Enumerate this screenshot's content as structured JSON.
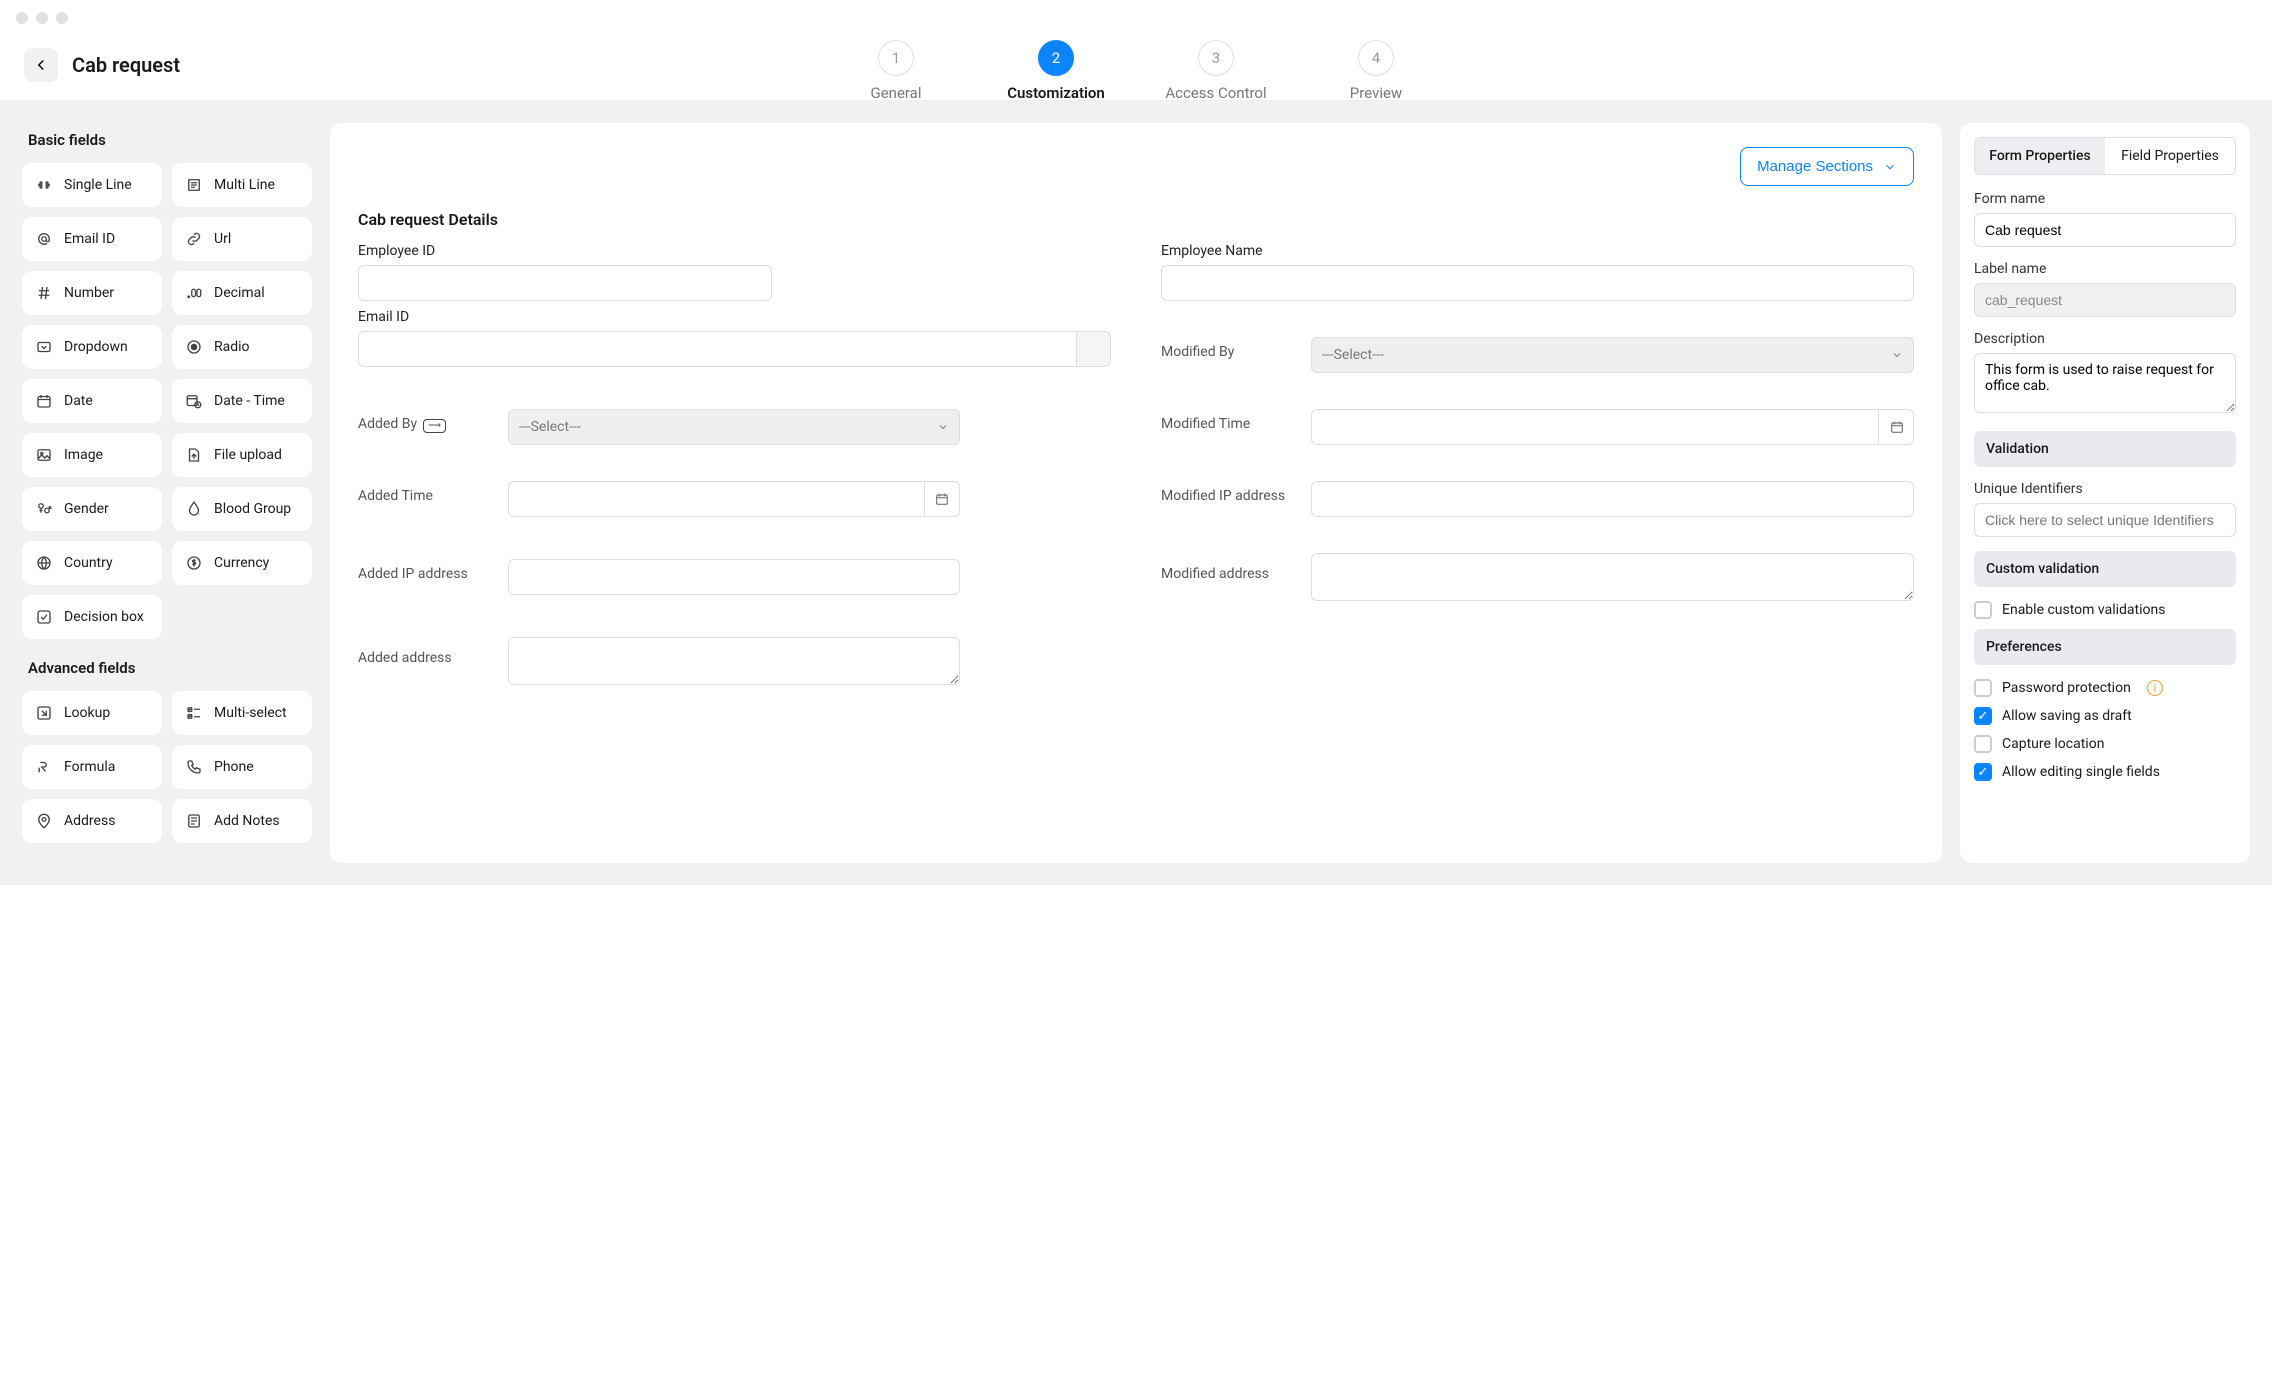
{
  "header": {
    "page_title": "Cab request",
    "wizard": [
      {
        "num": "1",
        "label": "General",
        "active": false
      },
      {
        "num": "2",
        "label": "Customization",
        "active": true
      },
      {
        "num": "3",
        "label": "Access Control",
        "active": false
      },
      {
        "num": "4",
        "label": "Preview",
        "active": false
      }
    ]
  },
  "left": {
    "basic_title": "Basic fields",
    "advanced_title": "Advanced fields",
    "basic": [
      "Single Line",
      "Multi Line",
      "Email ID",
      "Url",
      "Number",
      "Decimal",
      "Dropdown",
      "Radio",
      "Date",
      "Date - Time",
      "Image",
      "File upload",
      "Gender",
      "Blood Group",
      "Country",
      "Currency",
      "Decision box"
    ],
    "advanced": [
      "Lookup",
      "Multi-select",
      "Formula",
      "Phone",
      "Address",
      "Add Notes"
    ]
  },
  "center": {
    "manage_sections": "Manage Sections",
    "section_title": "Cab request Details",
    "select_placeholder": "---Select---",
    "labels": {
      "employee_id": "Employee ID",
      "employee_name": "Employee Name",
      "email_id": "Email ID",
      "modified_by": "Modified By",
      "added_by": "Added By",
      "modified_time": "Modified Time",
      "added_time": "Added Time",
      "modified_ip": "Modified IP address",
      "added_ip": "Added IP address",
      "modified_addr": "Modified address",
      "added_addr": "Added address"
    }
  },
  "right": {
    "tab_form": "Form Properties",
    "tab_field": "Field Properties",
    "form_name_label": "Form name",
    "form_name": "Cab request",
    "label_name_label": "Label name",
    "label_name": "cab_request",
    "description_label": "Description",
    "description": "This form is used to raise request for office cab.",
    "validation_header": "Validation",
    "unique_label": "Unique Identifiers",
    "unique_placeholder": "Click here to select unique Identifiers",
    "custom_validation_header": "Custom validation",
    "enable_custom": "Enable custom validations",
    "preferences_header": "Preferences",
    "prefs": [
      {
        "label": "Password protection",
        "checked": false,
        "info": true
      },
      {
        "label": "Allow saving as draft",
        "checked": true
      },
      {
        "label": "Capture location",
        "checked": false
      },
      {
        "label": "Allow editing single fields",
        "checked": true
      }
    ]
  }
}
